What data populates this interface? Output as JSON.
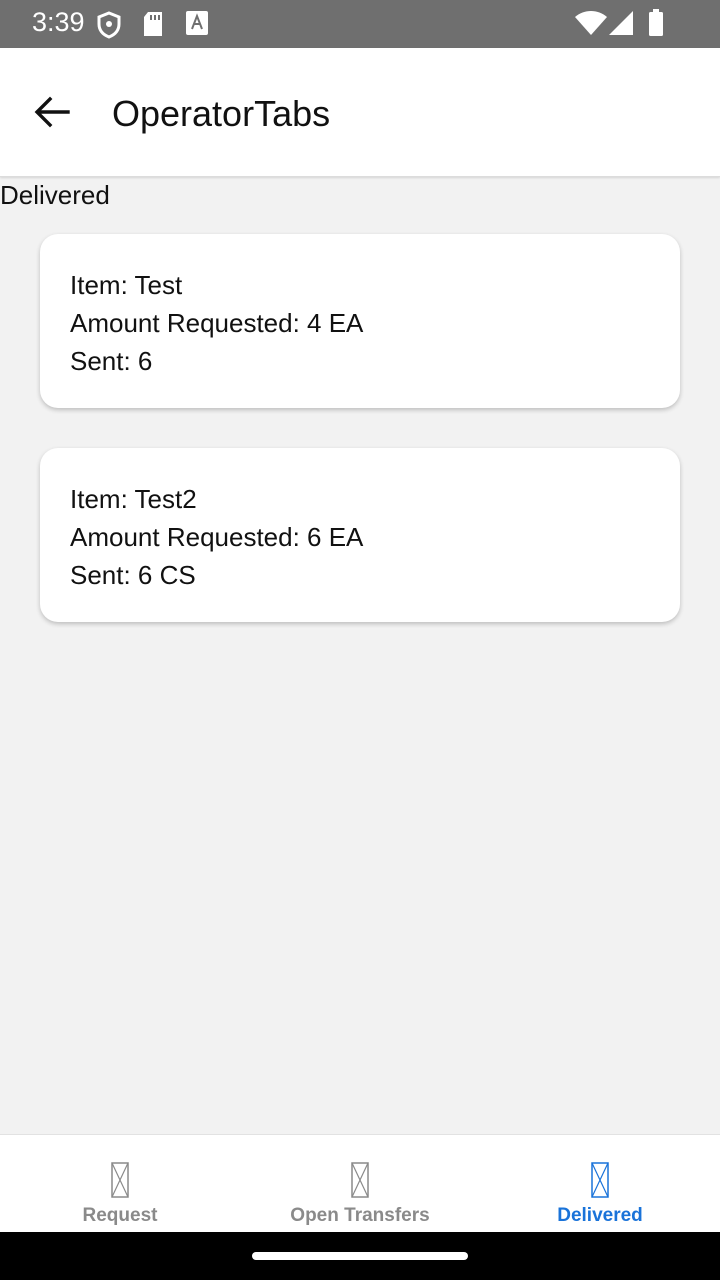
{
  "status_bar": {
    "time": "3:39",
    "left_icons": [
      "shield-icon",
      "sd-card-icon",
      "font-a-icon"
    ],
    "right_icons": [
      "wifi-icon",
      "signal-icon",
      "battery-icon"
    ]
  },
  "app_bar": {
    "back_icon": "arrow-left-icon",
    "title": "OperatorTabs"
  },
  "page": {
    "label": "Delivered"
  },
  "cards": [
    {
      "item": "Item: Test",
      "amount": "Amount Requested: 4 EA",
      "sent": "Sent: 6"
    },
    {
      "item": "Item: Test2",
      "amount": "Amount Requested: 6 EA",
      "sent": "Sent: 6 CS"
    }
  ],
  "bottom_nav": {
    "tabs": [
      {
        "label": "Request",
        "icon": "placeholder-icon",
        "active": false
      },
      {
        "label": "Open Transfers",
        "icon": "placeholder-icon",
        "active": false
      },
      {
        "label": "Delivered",
        "icon": "placeholder-icon",
        "active": true
      }
    ],
    "active_color": "#1a73d9",
    "inactive_color": "#8a8a8a"
  }
}
